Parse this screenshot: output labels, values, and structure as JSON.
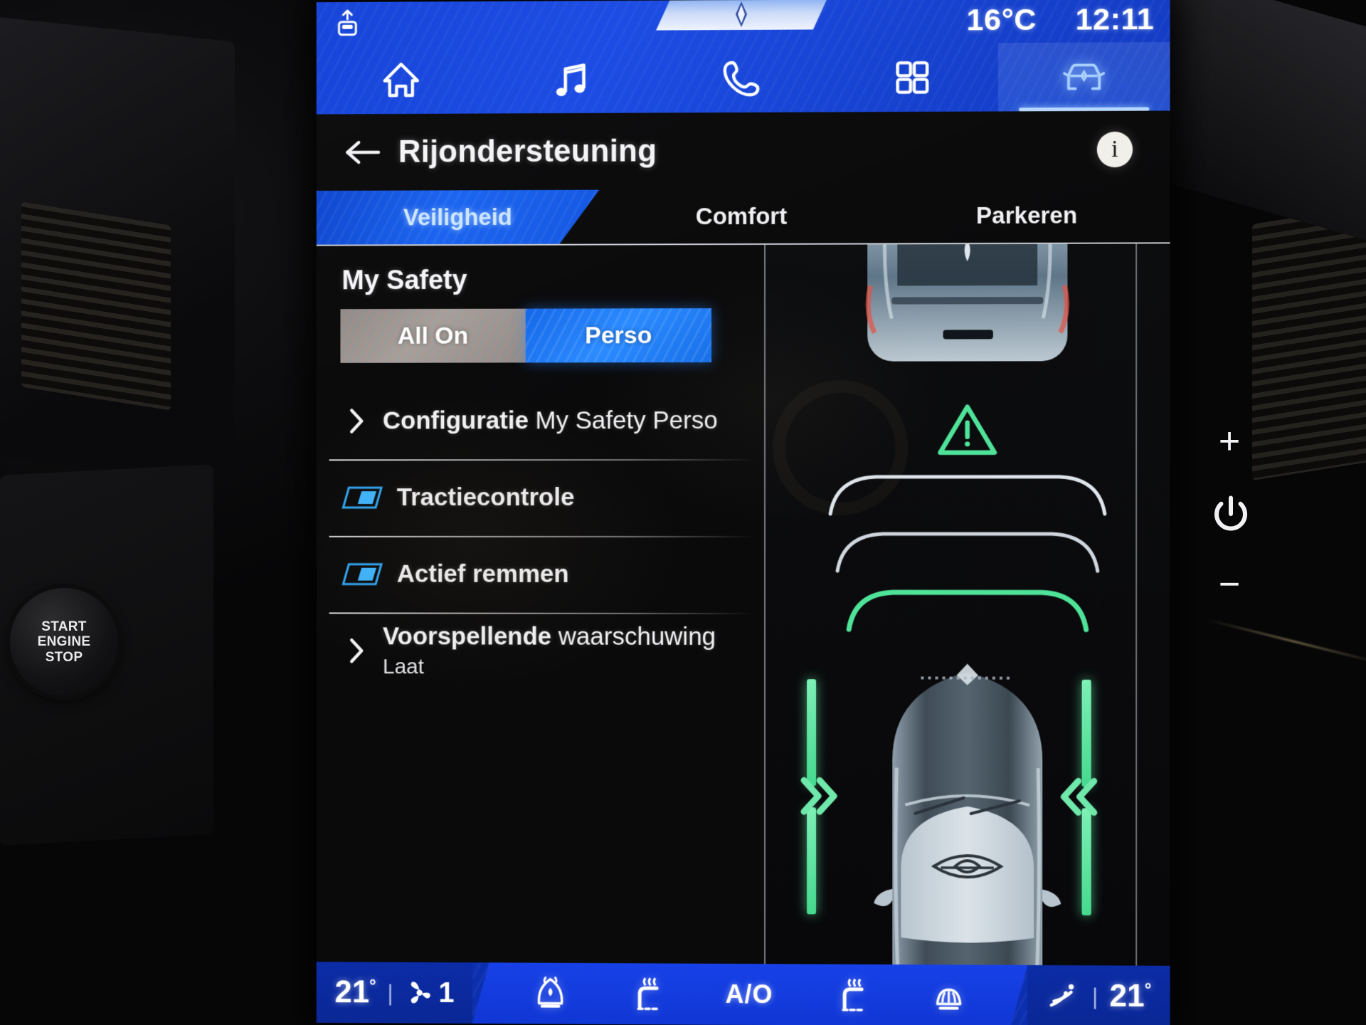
{
  "status_bar": {
    "drive_mode_icon": "car-door-open-icon",
    "brand_logo_icon": "renault-diamond-icon",
    "temperature": "16°C",
    "clock": "12:11"
  },
  "nav_bar": {
    "items": [
      {
        "icon": "home-icon",
        "name": "home",
        "active": false
      },
      {
        "icon": "music-note-icon",
        "name": "media",
        "active": false
      },
      {
        "icon": "phone-icon",
        "name": "phone",
        "active": false
      },
      {
        "icon": "apps-grid-icon",
        "name": "apps",
        "active": false
      },
      {
        "icon": "car-front-icon",
        "name": "vehicle",
        "active": true
      }
    ]
  },
  "header": {
    "back_icon": "back-arrow-icon",
    "title": "Rijondersteuning",
    "info_icon": "info-icon",
    "info_label": "i"
  },
  "tabs": [
    {
      "label": "Veiligheid",
      "active": true
    },
    {
      "label": "Comfort",
      "active": false
    },
    {
      "label": "Parkeren",
      "active": false
    }
  ],
  "main": {
    "section_title": "My Safety",
    "segmented": {
      "options": [
        {
          "label": "All On",
          "selected": false
        },
        {
          "label": "Perso",
          "selected": true
        }
      ]
    },
    "rows": [
      {
        "type": "submenu",
        "icon": "chevron-right-icon",
        "label_bold": "Configuratie",
        "label_rest": " My Safety Perso",
        "value": ""
      },
      {
        "type": "toggle",
        "icon": "toggle-on-icon",
        "label_bold": "Tractiecontrole",
        "label_rest": "",
        "value": "",
        "state": "on"
      },
      {
        "type": "toggle",
        "icon": "toggle-on-icon",
        "label_bold": "Actief remmen",
        "label_rest": "",
        "value": "",
        "state": "on"
      },
      {
        "type": "submenu",
        "icon": "chevron-right-icon",
        "label_bold": "Voorspellende",
        "label_rest": " waarschuwing",
        "value": "Laat"
      }
    ]
  },
  "visual": {
    "lead_vehicle_icon": "lead-car-rear-icon",
    "warning_icon": "warning-triangle-icon",
    "distance_arcs": 3,
    "ego_vehicle_icon": "ego-car-top-icon",
    "lane_markers": "lane-keep-assist-bars",
    "left_chevrons_icon": "chevrons-right-icon",
    "right_chevrons_icon": "chevrons-left-icon",
    "accent_green": "#56e59a",
    "accent_blue": "#1a64f0"
  },
  "climate_bar": {
    "left_temperature": "21",
    "left_degree": "°",
    "divider": "|",
    "fan_icon": "fan-icon",
    "fan_speed": "1",
    "buttons": [
      {
        "icon": "front-defrost-icon",
        "name": "front-defrost"
      },
      {
        "icon": "seat-heat-left-icon",
        "name": "seat-heat-left"
      },
      {
        "icon": "auto-climate-icon",
        "name": "auto-climate",
        "label": "A/O"
      },
      {
        "icon": "seat-heat-right-icon",
        "name": "seat-heat-right"
      },
      {
        "icon": "rear-defrost-icon",
        "name": "rear-defrost"
      }
    ],
    "airflow_icon": "airflow-icon",
    "right_divider": "|",
    "right_temperature": "21",
    "right_degree": "°"
  },
  "hardware": {
    "start_button_lines": "START\nENGINE\nSTOP",
    "start_line_1": "START",
    "start_line_2": "ENGINE",
    "start_line_3": "STOP",
    "volume_up": "+",
    "power_icon": "power-icon",
    "volume_down": "−"
  }
}
